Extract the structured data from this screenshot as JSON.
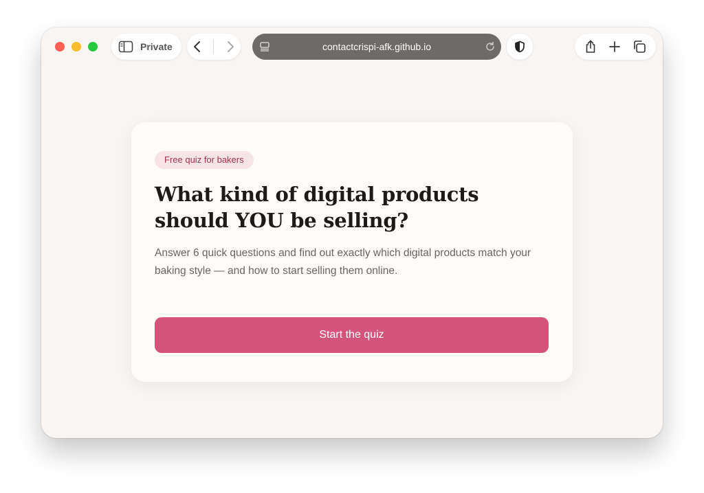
{
  "browser": {
    "private_label": "Private",
    "url": "contactcrispi-afk.github.io",
    "icons": {
      "sidebar": "sidebar-icon",
      "back": "chevron-left-icon",
      "forward": "chevron-right-icon",
      "page_menu": "page-menu-icon",
      "reload": "reload-icon",
      "privacy": "shield-icon",
      "share": "share-icon",
      "new_tab": "plus-icon",
      "tabs": "tabs-overview-icon"
    }
  },
  "quiz": {
    "badge": "Free quiz for bakers",
    "headline": "What kind of digital products should YOU be selling?",
    "description": "Answer 6 quick questions and find out exactly which digital products match your baking style — and how to start selling them online.",
    "cta_label": "Start the quiz"
  },
  "colors": {
    "accent": "#d4547d",
    "badge_bg": "#f7e4e6",
    "badge_text": "#a0324a",
    "page_bg": "#f9f5f3",
    "url_bar_bg": "#6e6a67"
  }
}
